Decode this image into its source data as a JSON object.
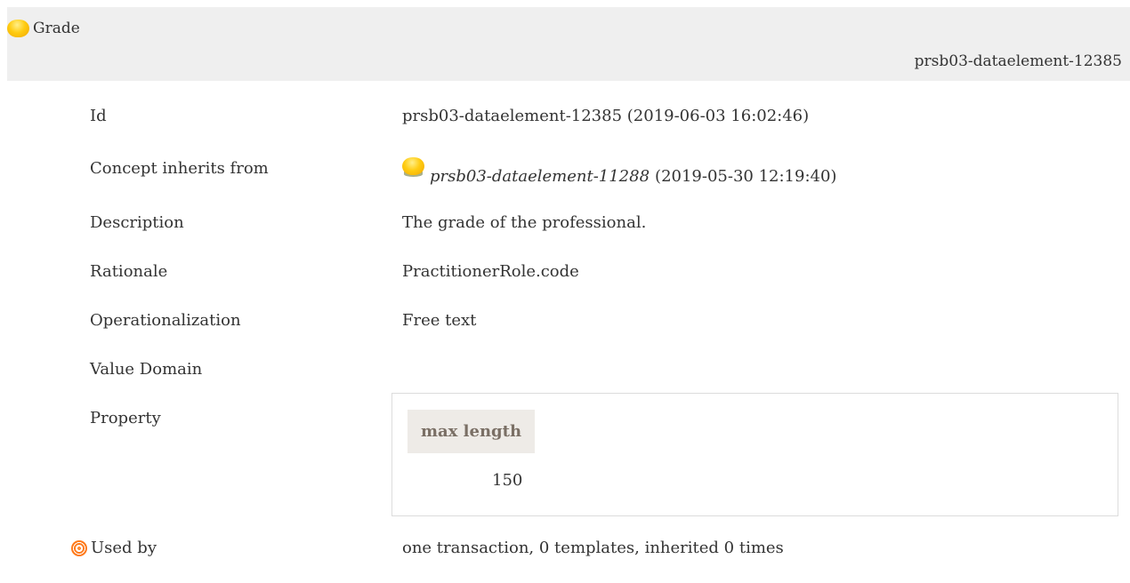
{
  "header": {
    "title": "Grade",
    "id": "prsb03-dataelement-12385",
    "icon": "concept-orb-icon"
  },
  "details": {
    "id": {
      "label": "Id",
      "value": "prsb03-dataelement-12385 (2019-06-03 16:02:46)"
    },
    "inherits": {
      "label": "Concept inherits from",
      "link": "prsb03-dataelement-11288",
      "timestamp": "(2019-05-30 12:19:40)",
      "icon": "concept-orb-icon"
    },
    "description": {
      "label": "Description",
      "value": "The grade of the professional."
    },
    "rationale": {
      "label": "Rationale",
      "value": "PractitionerRole.code"
    },
    "operationalization": {
      "label": "Operationalization",
      "value": "Free text"
    },
    "value_domain": {
      "label": "Value Domain"
    },
    "property": {
      "label": "Property",
      "column_header": "max length",
      "value": "150"
    },
    "used_by": {
      "label": "Used by",
      "value": "one transaction, 0 templates, inherited 0 times",
      "icon": "target-icon"
    }
  },
  "colors": {
    "header_bg": "#efefef",
    "property_header_bg": "#eeebe7",
    "orb": "#ffcc12",
    "target": "#ff7a1a"
  }
}
